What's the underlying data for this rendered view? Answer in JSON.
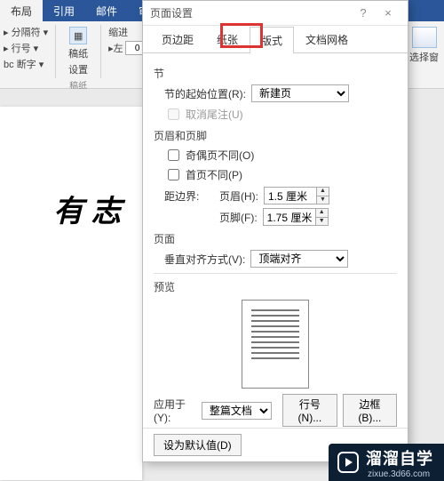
{
  "ribbon": {
    "tabs": [
      "布局",
      "引用",
      "邮件",
      "审阅"
    ],
    "active_tab": "布局",
    "controls": {
      "breaks": "分隔符",
      "line_numbers": "行号",
      "hyphenation": "断字",
      "manuscript": "稿纸",
      "manuscript_sub": "设置",
      "manuscript_group": "稿纸",
      "indent_label": "缩进",
      "left_val": "0",
      "select_pane": "选择窗"
    }
  },
  "document": {
    "visible_text": "有 志"
  },
  "dialog": {
    "title": "页面设置",
    "help": "?",
    "close": "×",
    "tabs": {
      "margins": "页边距",
      "paper": "纸张",
      "layout": "版式",
      "grid": "文档网格"
    },
    "active_tab": "layout",
    "section": {
      "title": "节",
      "start_label": "节的起始位置(R):",
      "start_value": "新建页",
      "suppress_endnotes": "取消尾注(U)"
    },
    "hf": {
      "title": "页眉和页脚",
      "odd_even": "奇偶页不同(O)",
      "first_page": "首页不同(P)",
      "distance_label": "距边界:",
      "header_label": "页眉(H):",
      "header_value": "1.5 厘米",
      "footer_label": "页脚(F):",
      "footer_value": "1.75 厘米"
    },
    "page": {
      "title": "页面",
      "valign_label": "垂直对齐方式(V):",
      "valign_value": "顶端对齐"
    },
    "preview_title": "预览",
    "apply_label": "应用于(Y):",
    "apply_value": "整篇文档",
    "line_numbers_btn": "行号(N)...",
    "borders_btn": "边框(B)...",
    "set_default": "设为默认值(D)"
  },
  "overlay": {
    "brand": "溜溜自学",
    "url": "zixue.3d66.com"
  }
}
